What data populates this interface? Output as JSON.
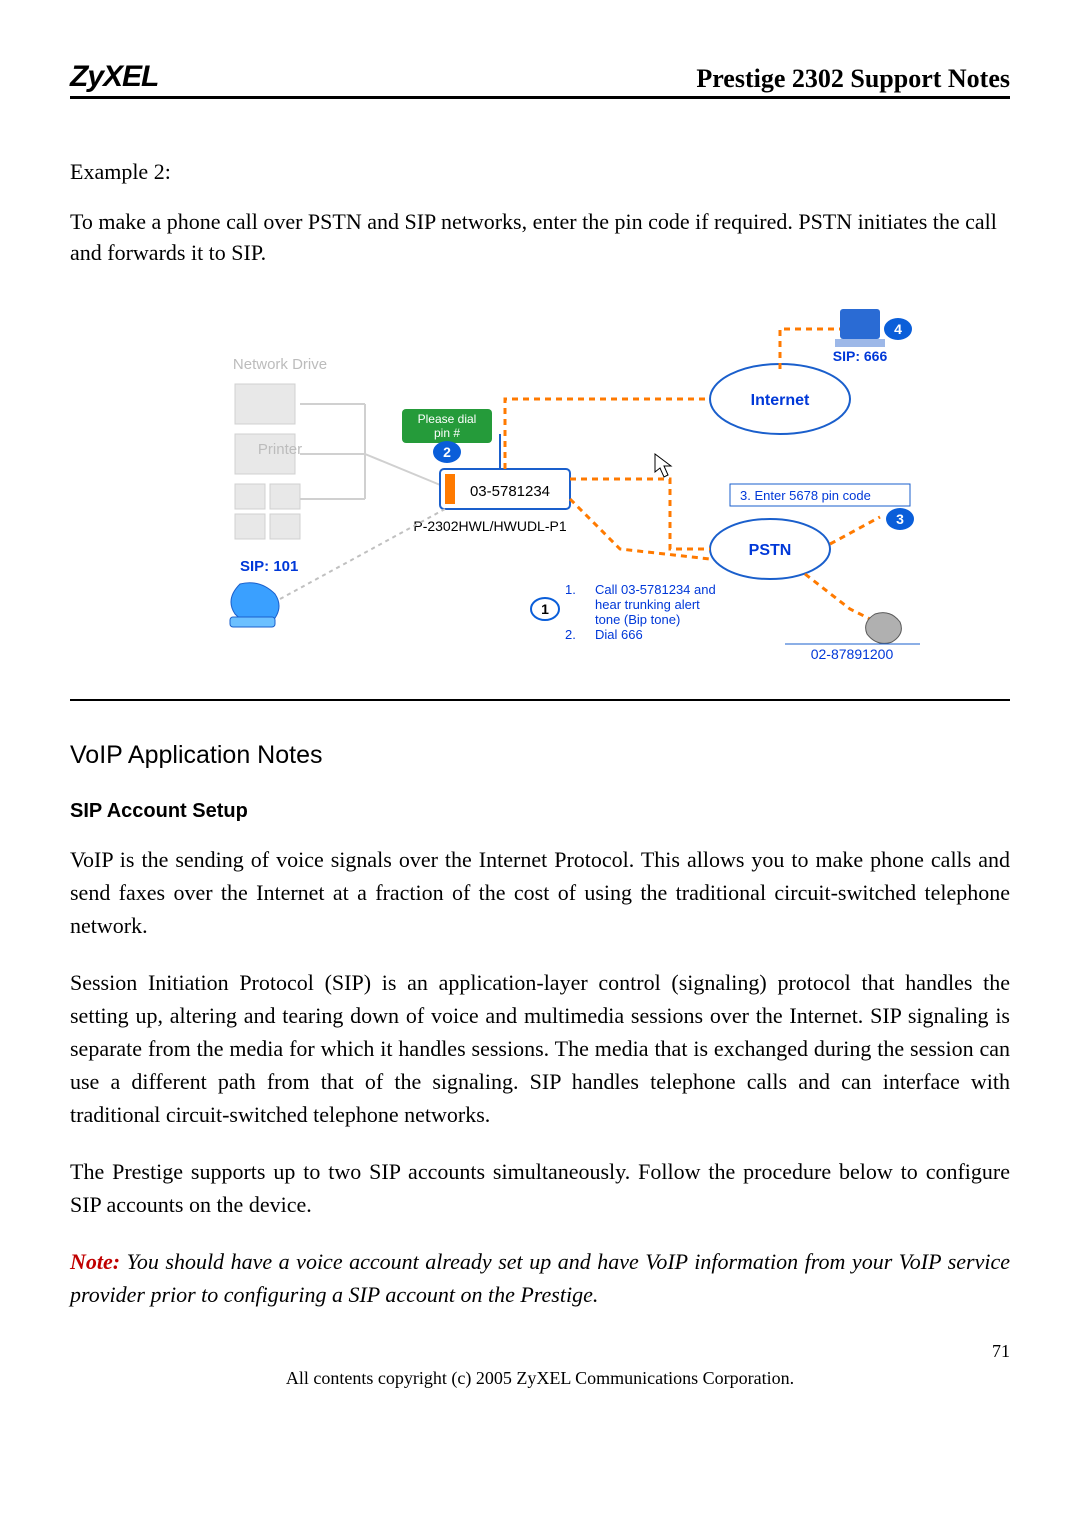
{
  "header": {
    "logo": "ZyXEL",
    "title": "Prestige 2302 Support Notes"
  },
  "example": {
    "label": "Example 2:",
    "body": "To make a phone call over PSTN and SIP networks, enter the pin code if required. PSTN initiates the call and forwards it to SIP."
  },
  "diagram": {
    "network_drive": "Network Drive",
    "printer": "Printer",
    "please_dial": "Please dial",
    "pin_hash": "pin #",
    "router_num": "03-5781234",
    "router_model": "P-2302HWL/HWUDL-P1",
    "sip101": "SIP: 101",
    "internet": "Internet",
    "sip666": "SIP: 666",
    "pstn": "PSTN",
    "enter_pin": "3.  Enter 5678 pin code",
    "call_1": "1.",
    "call_1_l1": "Call 03-5781234 and",
    "call_1_l2": "hear trunking alert",
    "call_1_l3": "tone (Bip tone)",
    "call_2": "2.",
    "call_2_l1": "Dial 666",
    "pstn_phone": "02-87891200",
    "badge2": "2",
    "badge4": "4",
    "badge3": "3",
    "badge1": "1"
  },
  "section": {
    "h2": "VoIP Application Notes",
    "h3": "SIP Account Setup",
    "p1": "VoIP is the sending of voice signals over the Internet Protocol. This allows you to make phone calls and send faxes over the Internet at a fraction of the cost of using the traditional circuit-switched telephone network.",
    "p2": "Session Initiation Protocol (SIP) is an application-layer control (signaling) protocol that handles the setting up, altering and tearing down of voice and multimedia sessions over the Internet. SIP signaling is separate from the media for which it handles sessions. The media that is exchanged during the session can use a different path from that of the signaling. SIP handles telephone calls and can interface with traditional circuit-switched telephone networks.",
    "p3": "The Prestige supports up to two SIP accounts simultaneously. Follow the procedure below to configure SIP accounts on the device.",
    "note_label": "Note:",
    "note_body": " You should have a voice account already set up and have VoIP information from your VoIP service provider prior to configuring a SIP account on the Prestige."
  },
  "footer": {
    "page": "71",
    "copyright": "All contents copyright (c) 2005 ZyXEL Communications Corporation."
  }
}
